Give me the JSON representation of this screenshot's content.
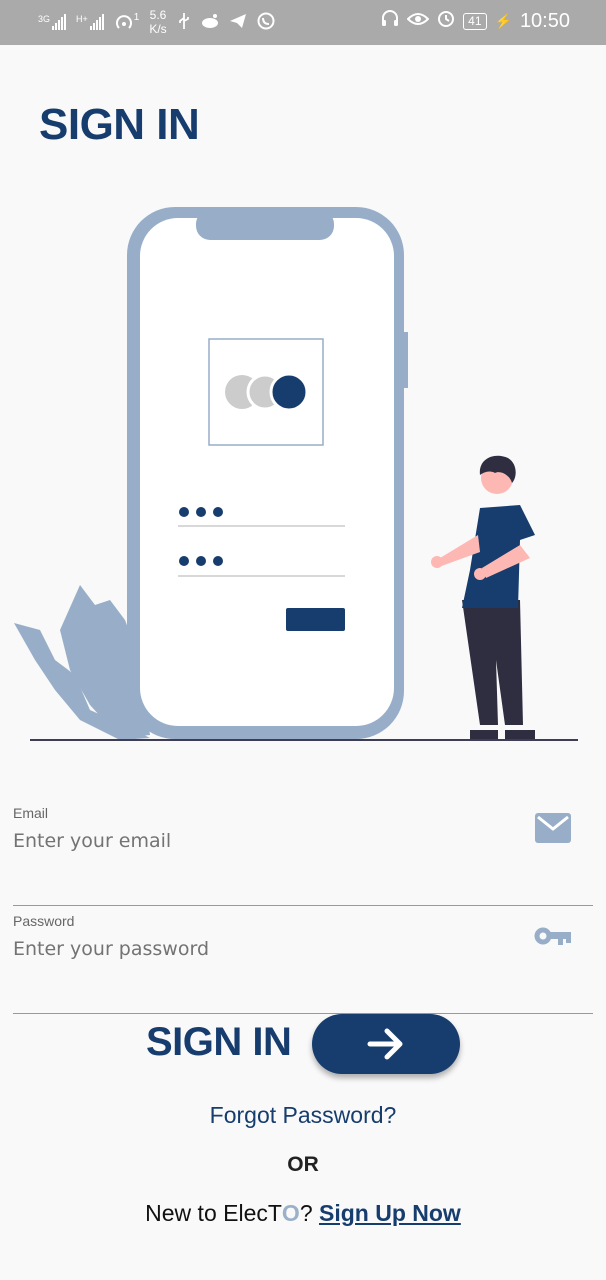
{
  "status_bar": {
    "net1": "3G",
    "net2": "H+",
    "hotspot_sub": "1",
    "speed_value": "5.6",
    "speed_unit": "K/s",
    "battery": "41",
    "time": "10:50",
    "icons": [
      "signal-icon",
      "hotspot-icon",
      "usb-icon",
      "app-icon",
      "telegram-icon",
      "whatsapp-icon",
      "headset-icon",
      "eye-icon",
      "alarm-icon",
      "battery-icon",
      "charging-icon"
    ]
  },
  "page_title": "SIGN IN",
  "illustration": {
    "colors": {
      "phone_frame": "#98aec8",
      "accent": "#163d6e",
      "skin": "#fdb8b4",
      "pants": "#2f2e41"
    }
  },
  "email": {
    "label": "Email",
    "placeholder": "Enter your email",
    "value": "",
    "icon": "mail-icon"
  },
  "password": {
    "label": "Password",
    "placeholder": "Enter your password",
    "value": "",
    "icon": "key-icon"
  },
  "signin": {
    "label": "SIGN IN",
    "button_icon": "arrow-right-icon"
  },
  "forgot_password": "Forgot Password?",
  "or_text": "OR",
  "new_to": {
    "prefix": "New to ElecT",
    "brand_o": "O",
    "question": "?",
    "signup_label": "Sign Up Now"
  },
  "colors": {
    "primary": "#163d6e",
    "status_bar": "#aaaaaa",
    "background": "#f9f9f9",
    "icon_gray": "#98aec8"
  }
}
